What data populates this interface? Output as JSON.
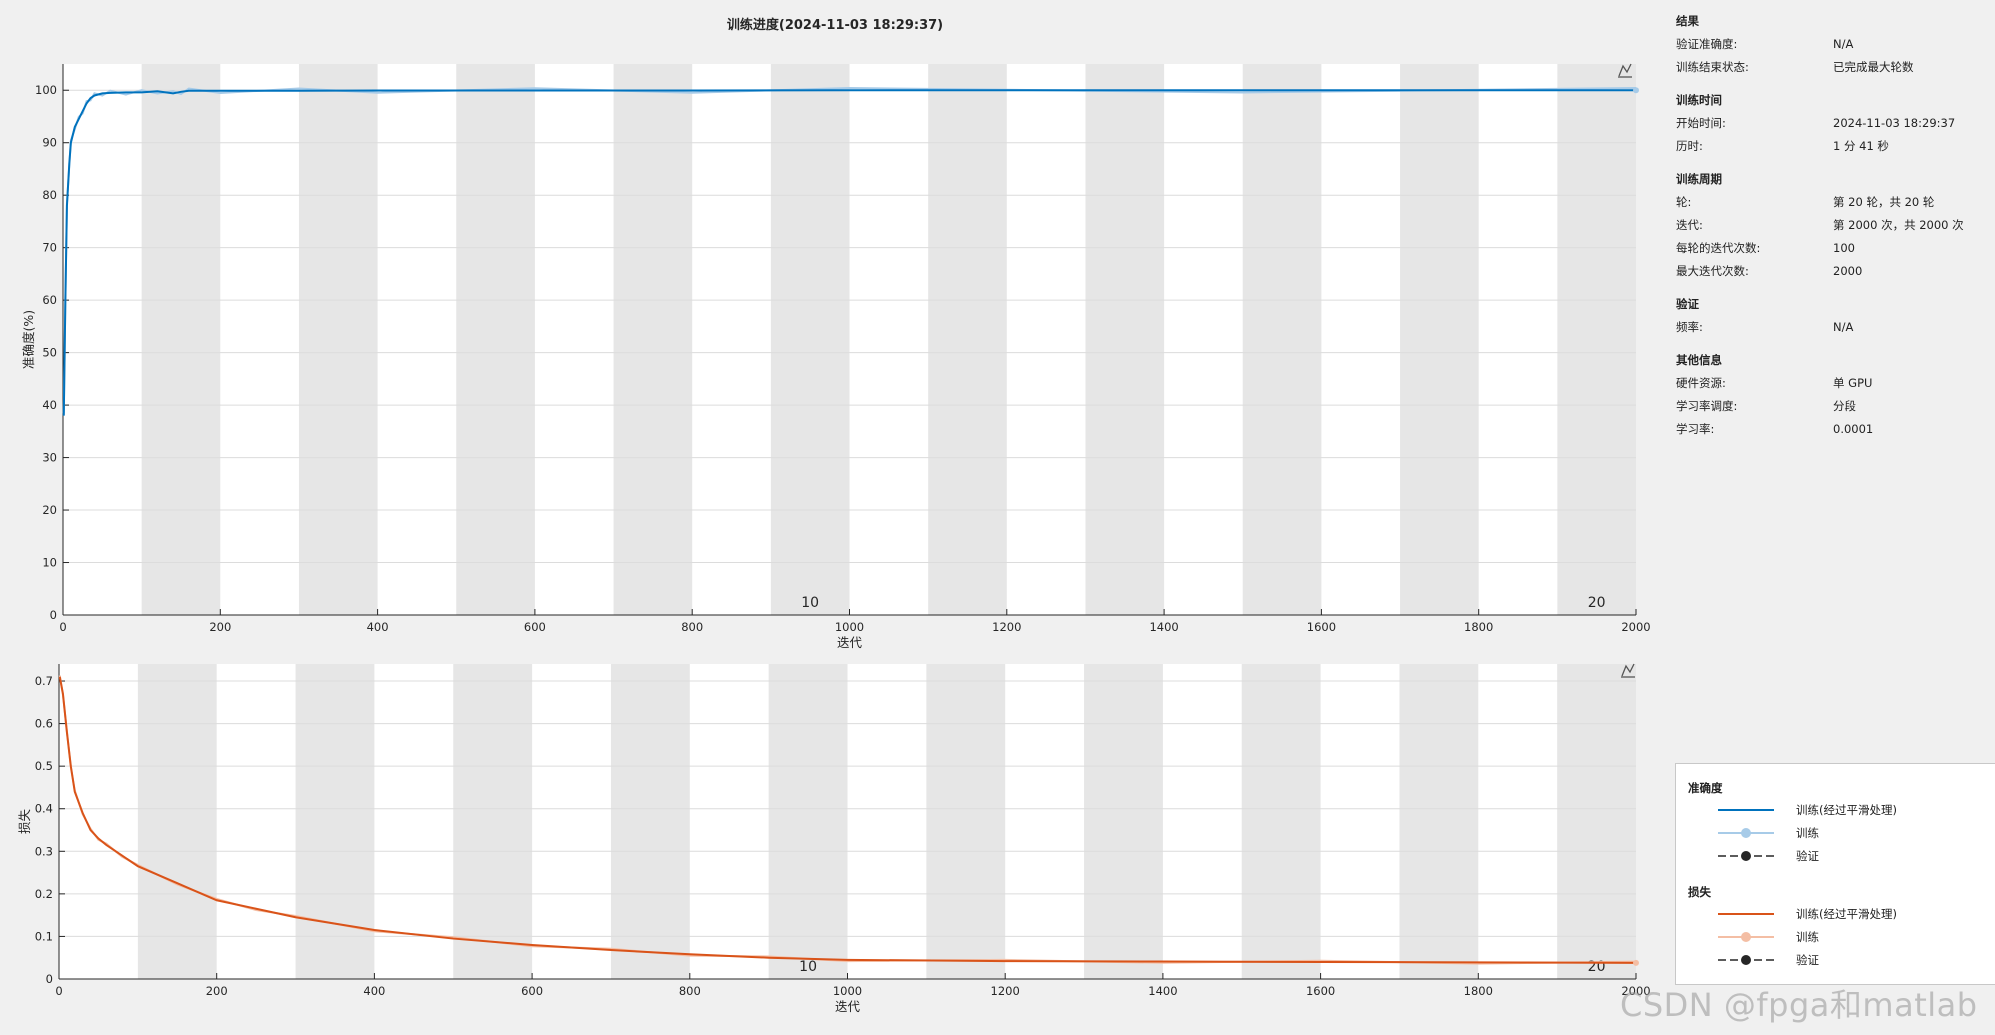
{
  "title": "训练进度(2024-11-03 18:29:37)",
  "watermark": "CSDN @fpga和matlab",
  "info": {
    "results": {
      "header": "结果",
      "rows": [
        {
          "label": "验证准确度:",
          "value": "N/A"
        },
        {
          "label": "训练结束状态:",
          "value": "已完成最大轮数"
        }
      ]
    },
    "time": {
      "header": "训练时间",
      "rows": [
        {
          "label": "开始时间:",
          "value": "2024-11-03 18:29:37"
        },
        {
          "label": "历时:",
          "value": "1 分 41 秒"
        }
      ]
    },
    "cycle": {
      "header": "训练周期",
      "rows": [
        {
          "label": "轮:",
          "value": "第 20 轮，共 20 轮"
        },
        {
          "label": "迭代:",
          "value": "第 2000 次，共 2000 次"
        },
        {
          "label": "每轮的迭代次数:",
          "value": "100"
        },
        {
          "label": "最大迭代次数:",
          "value": "2000"
        }
      ]
    },
    "validation": {
      "header": "验证",
      "rows": [
        {
          "label": "频率:",
          "value": "N/A"
        }
      ]
    },
    "other": {
      "header": "其他信息",
      "rows": [
        {
          "label": "硬件资源:",
          "value": "单 GPU"
        },
        {
          "label": "学习率调度:",
          "value": "分段"
        },
        {
          "label": "学习率:",
          "value": "0.0001"
        }
      ]
    }
  },
  "legend": {
    "accuracy_header": "准确度",
    "loss_header": "损失",
    "acc_items": [
      "训练(经过平滑处理)",
      "训练",
      "验证"
    ],
    "loss_items": [
      "训练(经过平滑处理)",
      "训练",
      "验证"
    ],
    "colors": {
      "acc_smooth": "#0072bd",
      "acc_raw": "#a7cbe8",
      "loss_smooth": "#d95319",
      "loss_raw": "#f4bea4",
      "val": "#262626"
    }
  },
  "chart_data": [
    {
      "type": "line",
      "title": "训练进度(2024-11-03 18:29:37)",
      "xlabel": "迭代",
      "ylabel": "准确度(%)",
      "xlim": [
        0,
        2000
      ],
      "ylim": [
        0,
        105
      ],
      "xticks": [
        0,
        200,
        400,
        600,
        800,
        1000,
        1200,
        1400,
        1600,
        1800,
        2000
      ],
      "yticks": [
        0,
        10,
        20,
        30,
        40,
        50,
        60,
        70,
        80,
        90,
        100
      ],
      "epoch_labels": [
        {
          "iteration": 1000,
          "label": "10"
        },
        {
          "iteration": 2000,
          "label": "20"
        }
      ],
      "epoch_length": 100,
      "grid": true,
      "series": [
        {
          "name": "训练(经过平滑处理)",
          "color": "#0072bd",
          "x": [
            1,
            3,
            5,
            8,
            10,
            15,
            20,
            25,
            30,
            35,
            40,
            50,
            60,
            80,
            100,
            120,
            140,
            150,
            160,
            200,
            300,
            400,
            600,
            800,
            1000,
            1500,
            2000
          ],
          "y": [
            38,
            60,
            78,
            86,
            90,
            93,
            94.5,
            96,
            97.5,
            98.5,
            99,
            99.4,
            99.5,
            99.6,
            99.6,
            99.8,
            99.4,
            99.7,
            99.9,
            99.9,
            99.9,
            99.95,
            99.95,
            99.95,
            100,
            100,
            100
          ]
        }
      ]
    },
    {
      "type": "line",
      "xlabel": "迭代",
      "ylabel": "损失",
      "xlim": [
        0,
        2000
      ],
      "ylim": [
        0,
        0.74
      ],
      "xticks": [
        0,
        200,
        400,
        600,
        800,
        1000,
        1200,
        1400,
        1600,
        1800,
        2000
      ],
      "yticks": [
        0,
        0.1,
        0.2,
        0.3,
        0.4,
        0.5,
        0.6,
        0.7
      ],
      "epoch_labels": [
        {
          "iteration": 1000,
          "label": "10"
        },
        {
          "iteration": 2000,
          "label": "20"
        }
      ],
      "epoch_length": 100,
      "grid": true,
      "series": [
        {
          "name": "训练(经过平滑处理)",
          "color": "#d95319",
          "x": [
            1,
            5,
            10,
            15,
            20,
            30,
            40,
            50,
            60,
            80,
            100,
            150,
            200,
            250,
            300,
            400,
            500,
            600,
            700,
            800,
            900,
            1000,
            1200,
            1400,
            1600,
            1800,
            2000
          ],
          "y": [
            0.71,
            0.67,
            0.58,
            0.5,
            0.44,
            0.39,
            0.35,
            0.33,
            0.315,
            0.29,
            0.265,
            0.225,
            0.185,
            0.165,
            0.145,
            0.115,
            0.095,
            0.08,
            0.068,
            0.058,
            0.05,
            0.045,
            0.042,
            0.041,
            0.04,
            0.039,
            0.038
          ]
        }
      ]
    }
  ]
}
